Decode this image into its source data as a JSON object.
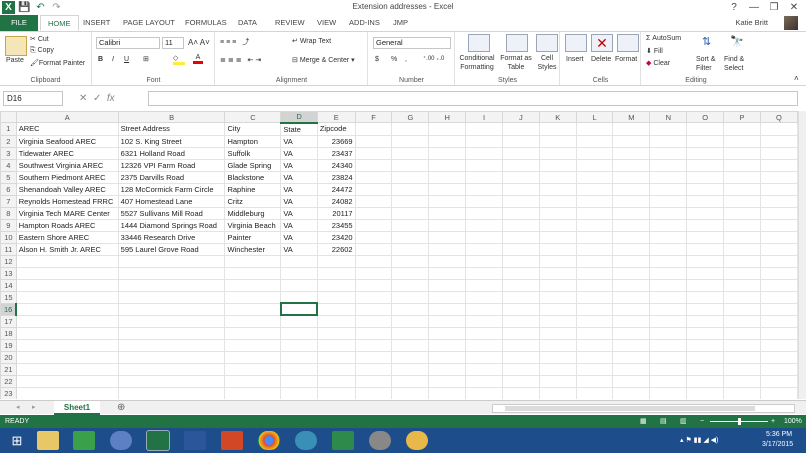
{
  "window": {
    "title": "Extension addresses - Excel",
    "help": "?",
    "min": "—",
    "restore": "❐",
    "close": "✕"
  },
  "qat": {
    "save": "💾",
    "undo": "↶",
    "redo": "↷"
  },
  "tabs": {
    "file": "FILE",
    "home": "HOME",
    "insert": "INSERT",
    "page_layout": "PAGE LAYOUT",
    "formulas": "FORMULAS",
    "data": "DATA",
    "review": "REVIEW",
    "view": "VIEW",
    "addins": "ADD-INS",
    "jmp": "JMP"
  },
  "user": "Katie Britt",
  "ribbon": {
    "clipboard": {
      "label": "Clipboard",
      "paste": "Paste",
      "cut": "Cut",
      "copy": "Copy",
      "format_painter": "Format Painter"
    },
    "font": {
      "label": "Font",
      "name": "Calibri",
      "size": "11",
      "bold": "B",
      "italic": "I",
      "underline": "U"
    },
    "alignment": {
      "label": "Alignment",
      "wrap": "Wrap Text",
      "merge": "Merge & Center"
    },
    "number": {
      "label": "Number",
      "format": "General",
      "currency": "$",
      "percent": "%",
      "comma": ","
    },
    "styles": {
      "label": "Styles",
      "conditional": "Conditional Formatting",
      "format_table": "Format as Table",
      "cell_styles": "Cell Styles"
    },
    "cells": {
      "label": "Cells",
      "insert": "Insert",
      "delete": "Delete",
      "format": "Format"
    },
    "editing": {
      "label": "Editing",
      "autosum": "AutoSum",
      "fill": "Fill",
      "clear": "Clear",
      "sort": "Sort & Filter",
      "find": "Find & Select"
    }
  },
  "namebox": "D16",
  "fx": "fx",
  "columns": [
    "A",
    "B",
    "C",
    "D",
    "E",
    "F",
    "G",
    "H",
    "I",
    "J",
    "K",
    "L",
    "M",
    "N",
    "O",
    "P",
    "Q"
  ],
  "rows": [
    [
      "AREC",
      "Street Address",
      "City",
      "State",
      "Zipcode"
    ],
    [
      "Virginia Seafood AREC",
      "102 S. King Street",
      "Hampton",
      "VA",
      "23669"
    ],
    [
      "Tidewater AREC",
      "6321 Holland Road",
      "Suffolk",
      "VA",
      "23437"
    ],
    [
      "Southwest Virginia AREC",
      "12326 VPI Farm Road",
      "Glade Spring",
      "VA",
      "24340"
    ],
    [
      "Southern Piedmont AREC",
      "2375 Darvills Road",
      "Blackstone",
      "VA",
      "23824"
    ],
    [
      "Shenandoah Valley AREC",
      "128 McCormick Farm Circle",
      "Raphine",
      "VA",
      "24472"
    ],
    [
      "Reynolds Homestead FRRC",
      "407 Homestead Lane",
      "Critz",
      "VA",
      "24082"
    ],
    [
      "Virginia Tech MARE Center",
      "5527 Sullivans Mill Road",
      "Middleburg",
      "VA",
      "20117"
    ],
    [
      "Hampton Roads AREC",
      "1444 Diamond Springs Road",
      "Virginia Beach",
      "VA",
      "23455"
    ],
    [
      "Eastern Shore AREC",
      "33446 Research Drive",
      "Painter",
      "VA",
      "23420"
    ],
    [
      "Alson H. Smith Jr. AREC",
      "595 Laurel Grove Road",
      "Winchester",
      "VA",
      "22602"
    ]
  ],
  "total_rows": 23,
  "selected": {
    "row": 16,
    "col": "D"
  },
  "sheet_tab": "Sheet1",
  "status": {
    "ready": "READY",
    "zoom": "100%"
  },
  "clock": {
    "time": "5:36 PM",
    "date": "3/17/2015"
  },
  "colors": {
    "excel_green": "#217346",
    "taskbar": "#1e4d8c"
  }
}
